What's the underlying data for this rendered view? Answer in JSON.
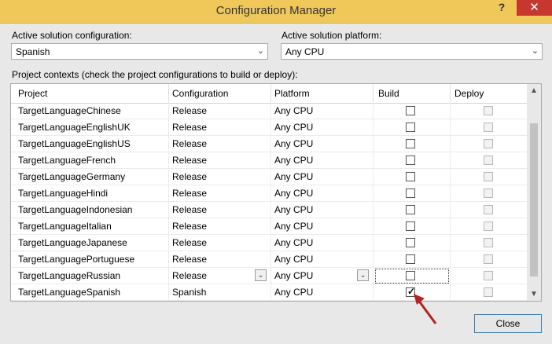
{
  "window": {
    "title": "Configuration Manager",
    "help": "?",
    "close": "✕"
  },
  "solution_config": {
    "label": "Active solution configuration:",
    "value": "Spanish"
  },
  "solution_platform": {
    "label": "Active solution platform:",
    "value": "Any CPU"
  },
  "contexts_label": "Project contexts (check the project configurations to build or deploy):",
  "columns": [
    "Project",
    "Configuration",
    "Platform",
    "Build",
    "Deploy"
  ],
  "rows": [
    {
      "project": "TargetLanguageChinese",
      "configuration": "Release",
      "platform": "Any CPU",
      "build": false
    },
    {
      "project": "TargetLanguageEnglishUK",
      "configuration": "Release",
      "platform": "Any CPU",
      "build": false
    },
    {
      "project": "TargetLanguageEnglishUS",
      "configuration": "Release",
      "platform": "Any CPU",
      "build": false
    },
    {
      "project": "TargetLanguageFrench",
      "configuration": "Release",
      "platform": "Any CPU",
      "build": false
    },
    {
      "project": "TargetLanguageGermany",
      "configuration": "Release",
      "platform": "Any CPU",
      "build": false
    },
    {
      "project": "TargetLanguageHindi",
      "configuration": "Release",
      "platform": "Any CPU",
      "build": false
    },
    {
      "project": "TargetLanguageIndonesian",
      "configuration": "Release",
      "platform": "Any CPU",
      "build": false
    },
    {
      "project": "TargetLanguageItalian",
      "configuration": "Release",
      "platform": "Any CPU",
      "build": false
    },
    {
      "project": "TargetLanguageJapanese",
      "configuration": "Release",
      "platform": "Any CPU",
      "build": false
    },
    {
      "project": "TargetLanguagePortuguese",
      "configuration": "Release",
      "platform": "Any CPU",
      "build": false
    },
    {
      "project": "TargetLanguageRussian",
      "configuration": "Release",
      "platform": "Any CPU",
      "build": false
    },
    {
      "project": "TargetLanguageSpanish",
      "configuration": "Spanish",
      "platform": "Any CPU",
      "build": true
    }
  ],
  "close_button": "Close",
  "colors": {
    "titlebar": "#f0c85a",
    "close": "#c7372f",
    "annotation_arrow": "#b22222"
  }
}
